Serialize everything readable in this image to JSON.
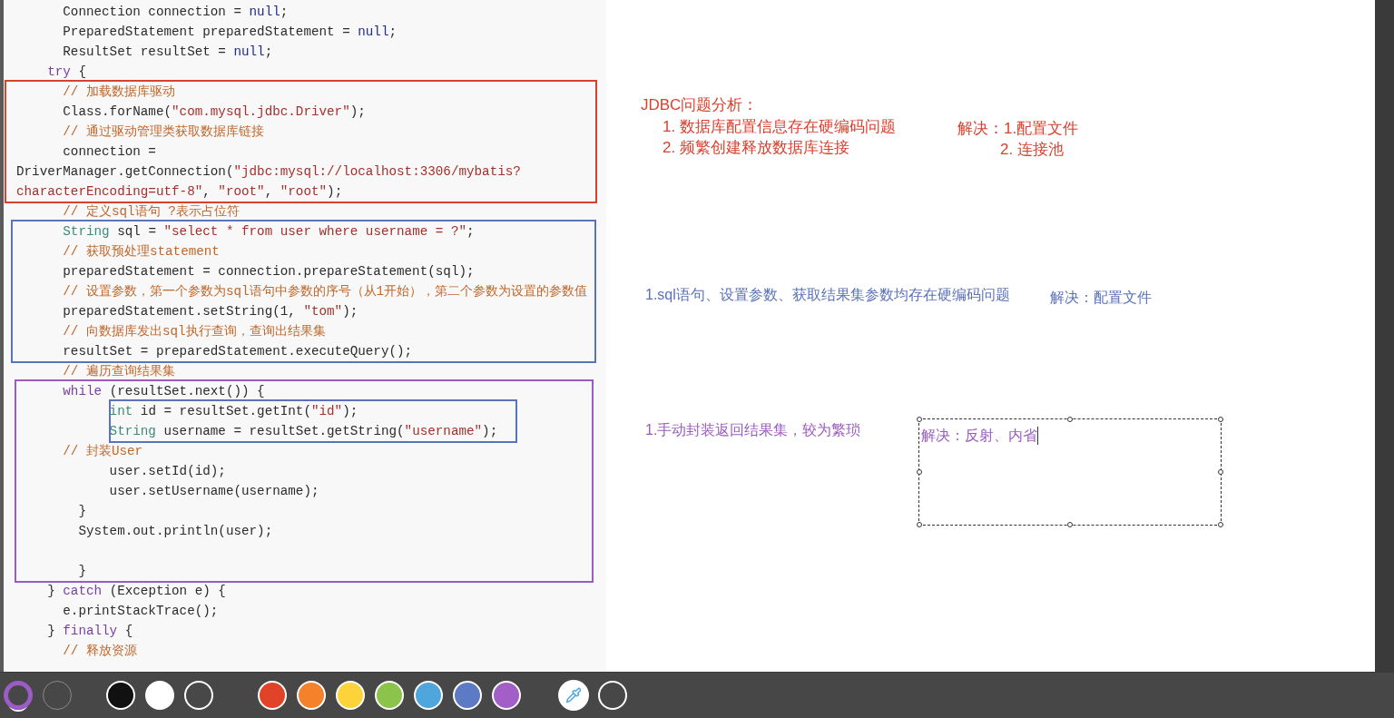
{
  "code": {
    "lines": [
      {
        "segments": [
          {
            "text": "      Connection connection = ",
            "kind": "plain"
          },
          {
            "text": "null",
            "kind": "literal"
          },
          {
            "text": ";",
            "kind": "plain"
          }
        ]
      },
      {
        "segments": [
          {
            "text": "      PreparedStatement preparedStatement = ",
            "kind": "plain"
          },
          {
            "text": "null",
            "kind": "literal"
          },
          {
            "text": ";",
            "kind": "plain"
          }
        ]
      },
      {
        "segments": [
          {
            "text": "      ResultSet resultSet = ",
            "kind": "plain"
          },
          {
            "text": "null",
            "kind": "literal"
          },
          {
            "text": ";",
            "kind": "plain"
          }
        ]
      },
      {
        "segments": [
          {
            "text": "    try",
            "kind": "keyword"
          },
          {
            "text": " {",
            "kind": "plain"
          }
        ]
      },
      {
        "segments": [
          {
            "text": "      // 加载数据库驱动",
            "kind": "comment"
          }
        ]
      },
      {
        "segments": [
          {
            "text": "      Class.forName(",
            "kind": "plain"
          },
          {
            "text": "\"com.mysql.jdbc.Driver\"",
            "kind": "string"
          },
          {
            "text": ");",
            "kind": "plain"
          }
        ]
      },
      {
        "segments": [
          {
            "text": "      // 通过驱动管理类获取数据库链接",
            "kind": "comment"
          }
        ]
      },
      {
        "segments": [
          {
            "text": "      connection =",
            "kind": "plain"
          }
        ]
      },
      {
        "segments": [
          {
            "text": "DriverManager.getConnection(",
            "kind": "plain"
          },
          {
            "text": "\"jdbc:mysql://localhost:3306/mybatis?",
            "kind": "string"
          }
        ]
      },
      {
        "segments": [
          {
            "text": "characterEncoding=utf-8\"",
            "kind": "string"
          },
          {
            "text": ", ",
            "kind": "plain"
          },
          {
            "text": "\"root\"",
            "kind": "string"
          },
          {
            "text": ", ",
            "kind": "plain"
          },
          {
            "text": "\"root\"",
            "kind": "string"
          },
          {
            "text": ");",
            "kind": "plain"
          }
        ]
      },
      {
        "segments": [
          {
            "text": "      // 定义sql语句 ?表示占位符",
            "kind": "comment"
          }
        ]
      },
      {
        "segments": [
          {
            "text": "      String",
            "kind": "type"
          },
          {
            "text": " sql = ",
            "kind": "plain"
          },
          {
            "text": "\"select * from user where username = ?\"",
            "kind": "string"
          },
          {
            "text": ";",
            "kind": "plain"
          }
        ]
      },
      {
        "segments": [
          {
            "text": "      // 获取预处理statement",
            "kind": "comment"
          }
        ]
      },
      {
        "segments": [
          {
            "text": "      preparedStatement = connection.prepareStatement(sql);",
            "kind": "plain"
          }
        ]
      },
      {
        "segments": [
          {
            "text": "      // 设置参数，第一个参数为sql语句中参数的序号（从1开始），第二个参数为设置的参数值",
            "kind": "comment"
          }
        ]
      },
      {
        "segments": [
          {
            "text": "      preparedStatement.setString(1, ",
            "kind": "plain"
          },
          {
            "text": "\"tom\"",
            "kind": "string"
          },
          {
            "text": ");",
            "kind": "plain"
          }
        ]
      },
      {
        "segments": [
          {
            "text": "      // 向数据库发出sql执行查询，查询出结果集",
            "kind": "comment"
          }
        ]
      },
      {
        "segments": [
          {
            "text": "      resultSet = preparedStatement.executeQuery();",
            "kind": "plain"
          }
        ]
      },
      {
        "segments": [
          {
            "text": "      // 遍历查询结果集",
            "kind": "comment"
          }
        ]
      },
      {
        "segments": [
          {
            "text": "      while",
            "kind": "keyword"
          },
          {
            "text": " (resultSet.next()) {",
            "kind": "plain"
          }
        ]
      },
      {
        "segments": [
          {
            "text": "            int",
            "kind": "type"
          },
          {
            "text": " id = resultSet.getInt(",
            "kind": "plain"
          },
          {
            "text": "\"id\"",
            "kind": "string"
          },
          {
            "text": ");",
            "kind": "plain"
          }
        ]
      },
      {
        "segments": [
          {
            "text": "            String",
            "kind": "type"
          },
          {
            "text": " username = resultSet.getString(",
            "kind": "plain"
          },
          {
            "text": "\"username\"",
            "kind": "string"
          },
          {
            "text": ");",
            "kind": "plain"
          }
        ]
      },
      {
        "segments": [
          {
            "text": "      // 封装User",
            "kind": "comment"
          }
        ]
      },
      {
        "segments": [
          {
            "text": "            user.setId(id);",
            "kind": "plain"
          }
        ]
      },
      {
        "segments": [
          {
            "text": "            user.setUsername(username);",
            "kind": "plain"
          }
        ]
      },
      {
        "segments": [
          {
            "text": "        }",
            "kind": "plain"
          }
        ]
      },
      {
        "segments": [
          {
            "text": "        System.out.println(user);",
            "kind": "plain"
          }
        ]
      },
      {
        "kind": "blank"
      },
      {
        "segments": [
          {
            "text": "        }",
            "kind": "plain"
          }
        ]
      },
      {
        "segments": [
          {
            "text": "    } ",
            "kind": "plain"
          },
          {
            "text": "catch",
            "kind": "keyword"
          },
          {
            "text": " (Exception e) {",
            "kind": "plain"
          }
        ]
      },
      {
        "segments": [
          {
            "text": "      e.printStackTrace();",
            "kind": "plain"
          }
        ]
      },
      {
        "segments": [
          {
            "text": "    } ",
            "kind": "plain"
          },
          {
            "text": "finally",
            "kind": "keyword"
          },
          {
            "text": " {",
            "kind": "plain"
          }
        ]
      },
      {
        "segments": [
          {
            "text": "      // 释放资源",
            "kind": "comment"
          }
        ]
      }
    ]
  },
  "annotation_boxes": [
    {
      "color": "#d9412f"
    },
    {
      "color": "#5a72b8"
    },
    {
      "color": "#9a5cc0"
    },
    {
      "color": "#5a72b8"
    }
  ],
  "notes": [
    {
      "text": "JDBC问题分析：",
      "color": "#d9412f"
    },
    {
      "text": "1. 数据库配置信息存在硬编码问题",
      "color": "#d9412f"
    },
    {
      "text": "2. 频繁创建释放数据库连接",
      "color": "#d9412f"
    },
    {
      "text": "解决：1.配置文件",
      "color": "#d9412f"
    },
    {
      "text": "2. 连接池",
      "color": "#d9412f"
    },
    {
      "text": "1.sql语句、设置参数、获取结果集参数均存在硬编码问题",
      "color": "#5a72b8"
    },
    {
      "text": "解决：配置文件",
      "color": "#5a72b8"
    },
    {
      "text": "1.手动封装返回结果集，较为繁琐",
      "color": "#9a5cc0"
    }
  ],
  "text_box": {
    "text": "解决：反射、内省",
    "color": "#9a5cc0",
    "editing": true
  },
  "toolbar": {
    "pen_sizes": [
      {
        "selected": true
      },
      {
        "selected": false
      }
    ],
    "colors": [
      {
        "color": "#111111"
      },
      {
        "color": "#ffffff"
      },
      {
        "color": "#484848"
      },
      {
        "color": "#e04327"
      },
      {
        "color": "#f5812b"
      },
      {
        "color": "#fdd33a"
      },
      {
        "color": "#8cc34b"
      },
      {
        "color": "#4fa6dc"
      },
      {
        "color": "#5c7bc4"
      },
      {
        "color": "#a25fc8"
      }
    ]
  }
}
